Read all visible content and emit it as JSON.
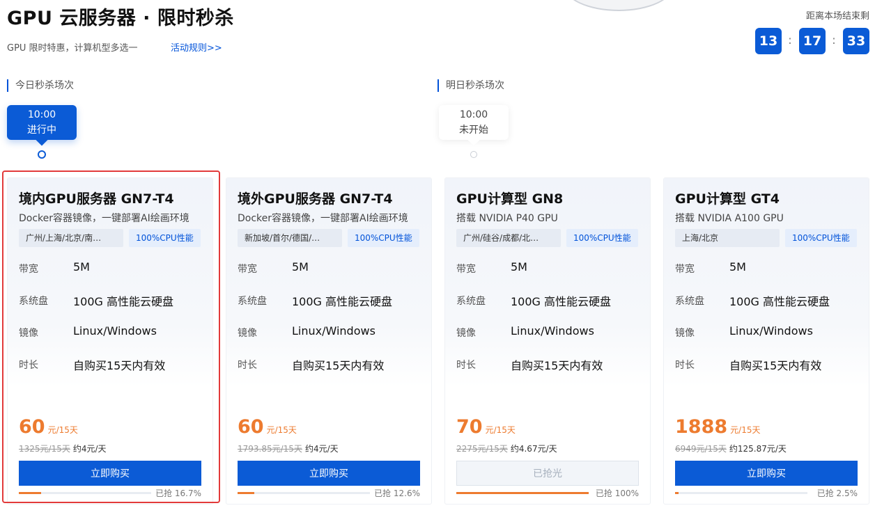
{
  "header": {
    "title": "GPU 云服务器 · 限时秒杀",
    "subtitle": "GPU 限时特惠，计算机型多选一",
    "rules_link": "活动规则>>"
  },
  "countdown": {
    "label": "距离本场结束剩",
    "hours": "13",
    "minutes": "17",
    "seconds": "33",
    "separator": ":"
  },
  "sessions": [
    {
      "label": "今日秒杀场次",
      "time": "10:00",
      "status": "进行中",
      "active": true
    },
    {
      "label": "明日秒杀场次",
      "time": "10:00",
      "status": "未开始",
      "active": false
    }
  ],
  "spec_labels": {
    "bandwidth": "带宽",
    "disk": "系统盘",
    "image": "镜像",
    "duration": "时长"
  },
  "colors": {
    "brand": "#0b5bd6",
    "price": "#ed7b2f",
    "highlight": "#e23a3a"
  },
  "cards": [
    {
      "title": "境内GPU服务器 GN7-T4",
      "desc": "Docker容器镜像，一键部署AI绘画环境",
      "region_tag": "广州/上海/北京/南…",
      "cpu_tag": "100%CPU性能",
      "bandwidth": "5M",
      "disk": "100G 高性能云硬盘",
      "image": "Linux/Windows",
      "duration": "自购买15天内有效",
      "price": "60",
      "price_unit": "元/15天",
      "original_price": "1325元/15天",
      "per_day": "约4元/天",
      "button": "立即购买",
      "button_enabled": true,
      "sold_label": "已抢 16.7%",
      "sold_fraction": 0.167
    },
    {
      "title": "境外GPU服务器 GN7-T4",
      "desc": "Docker容器镜像，一键部署AI绘画环境",
      "region_tag": "新加坡/首尔/德国/…",
      "cpu_tag": "100%CPU性能",
      "bandwidth": "5M",
      "disk": "100G 高性能云硬盘",
      "image": "Linux/Windows",
      "duration": "自购买15天内有效",
      "price": "60",
      "price_unit": "元/15天",
      "original_price": "1793.85元/15天",
      "per_day": "约4元/天",
      "button": "立即购买",
      "button_enabled": true,
      "sold_label": "已抢 12.6%",
      "sold_fraction": 0.126
    },
    {
      "title": "GPU计算型 GN8",
      "desc": "搭载 NVIDIA P40 GPU",
      "region_tag": "广州/硅谷/成都/北…",
      "cpu_tag": "100%CPU性能",
      "bandwidth": "5M",
      "disk": "100G 高性能云硬盘",
      "image": "Linux/Windows",
      "duration": "自购买15天内有效",
      "price": "70",
      "price_unit": "元/15天",
      "original_price": "2275元/15天",
      "per_day": "约4.67元/天",
      "button": "已抢光",
      "button_enabled": false,
      "sold_label": "已抢 100%",
      "sold_fraction": 1.0
    },
    {
      "title": "GPU计算型 GT4",
      "desc": "搭载 NVIDIA A100 GPU",
      "region_tag": "上海/北京",
      "cpu_tag": "100%CPU性能",
      "bandwidth": "5M",
      "disk": "100G 高性能云硬盘",
      "image": "Linux/Windows",
      "duration": "自购买15天内有效",
      "price": "1888",
      "price_unit": "元/15天",
      "original_price": "6949元/15天",
      "per_day": "约125.87元/天",
      "button": "立即购买",
      "button_enabled": true,
      "sold_label": "已抢 2.5%",
      "sold_fraction": 0.025
    }
  ]
}
